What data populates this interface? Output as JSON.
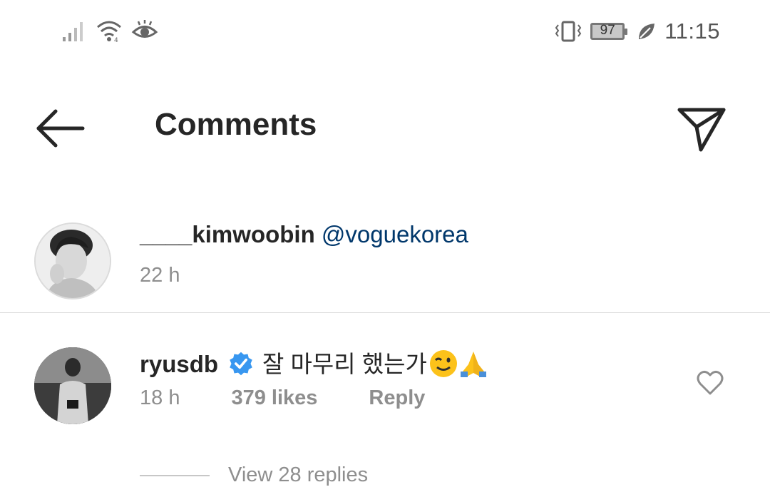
{
  "status_bar": {
    "signal_icon": "signal-bars-icon",
    "wifi_icon": "wifi-icon",
    "eye_icon": "eye-comfort-icon",
    "vibrate_icon": "vibrate-icon",
    "battery_level": "97",
    "leaf_icon": "leaf-icon",
    "time": "11:15"
  },
  "header": {
    "title": "Comments",
    "back_icon": "arrow-left-icon",
    "send_icon": "paper-plane-icon"
  },
  "caption": {
    "username": "____kimwoobin",
    "mention": "@voguekorea",
    "time": "22 h"
  },
  "comment": {
    "username": "ryusdb",
    "verified_icon": "verified-badge-icon",
    "text": "잘 마무리 했는가",
    "emojis": [
      "winking-face-icon",
      "folded-hands-icon"
    ],
    "time": "18 h",
    "likes": "379 likes",
    "reply_label": "Reply",
    "heart_icon": "heart-outline-icon",
    "view_replies": "View 28 replies"
  },
  "colors": {
    "text": "#262626",
    "secondary": "#8e8e8e",
    "mention": "#00376b",
    "verified": "#3897f0",
    "divider": "#dbdbdb"
  }
}
